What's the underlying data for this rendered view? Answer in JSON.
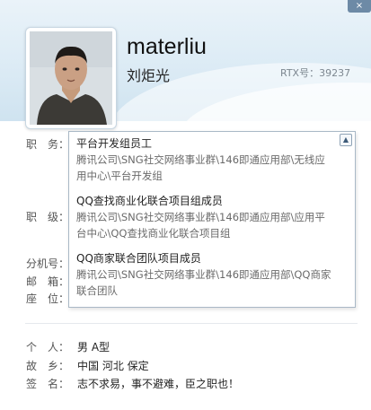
{
  "header": {
    "close_label": "×",
    "name": "materliu",
    "chinese_name": "刘炬光",
    "rtx": "RTX号：39237"
  },
  "fields": {
    "position_label": "职　务：",
    "level_label": "职　级：",
    "extension_label": "分机号：",
    "email_label": "邮　箱：",
    "seat_label": "座　位："
  },
  "positions": [
    {
      "title": "平台开发组员工",
      "path_lines": [
        "腾讯公司\\SNG社交网络事业群\\146即通应用部\\无线应",
        "用中心\\平台开发组"
      ]
    },
    {
      "title": "QQ查找商业化联合项目组成员",
      "path_lines": [
        "腾讯公司\\SNG社交网络事业群\\146即通应用部\\应用平",
        "台中心\\QQ查找商业化联合项目组"
      ]
    },
    {
      "title": "QQ商家联合团队项目成员",
      "path_lines": [
        "腾讯公司\\SNG社交网络事业群\\146即通应用部\\QQ商家",
        "联合团队"
      ]
    }
  ],
  "personal": {
    "personal_label": "个　人：",
    "personal_value": "男 A型",
    "hometown_label": "故　乡：",
    "hometown_value": "中国 河北 保定",
    "signature_label": "签　名：",
    "signature_value": "志不求易，事不避难，臣之职也！"
  }
}
